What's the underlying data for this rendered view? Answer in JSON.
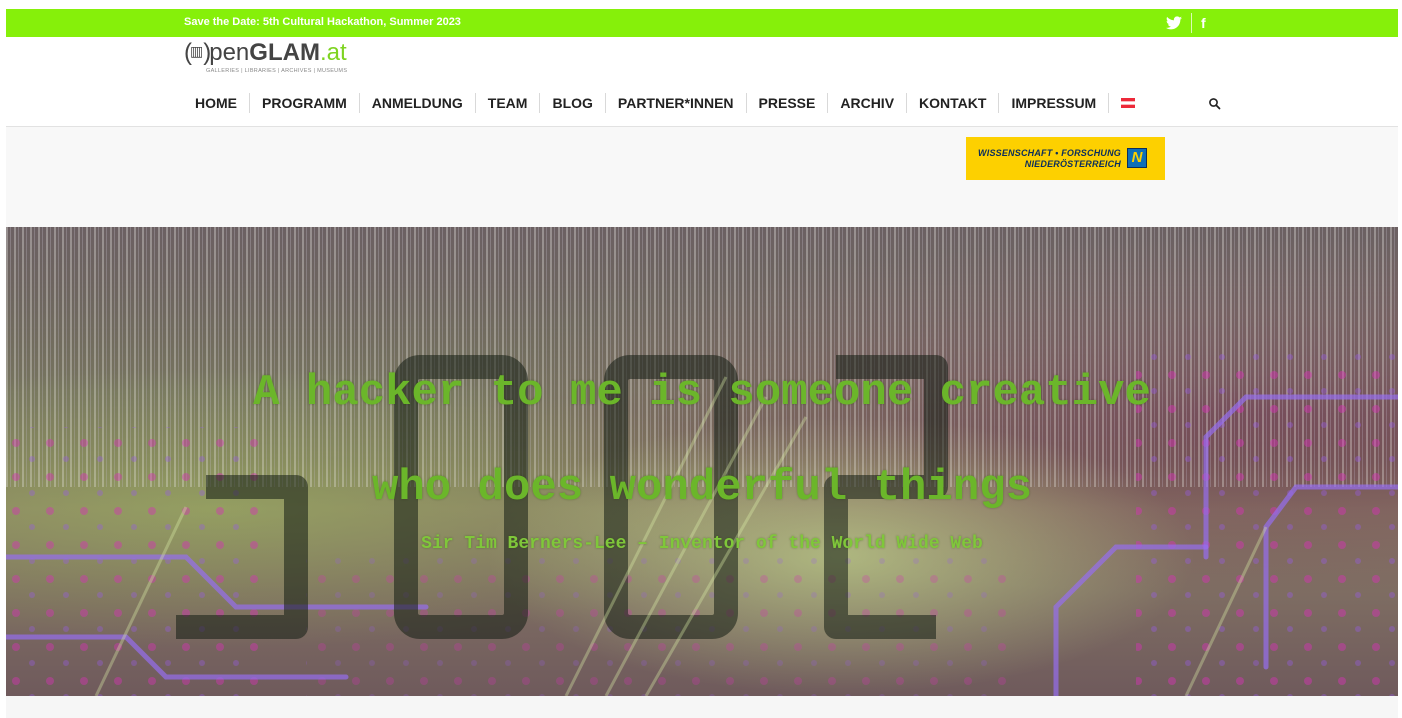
{
  "topbar": {
    "announcement": "Save the Date: 5th Cultural Hackathon, Summer 2023",
    "social": [
      {
        "icon": "twitter-icon"
      },
      {
        "icon": "facebook-icon",
        "glyph": "f"
      }
    ],
    "accent_color": "#86f00a"
  },
  "logo": {
    "bracket": "(",
    "mark": "▥",
    "word_pen": "pen",
    "word_glam": "GLAM",
    "word_at": ".at",
    "subtitle": "GALLERIES | LIBRARIES | ARCHIVES | MUSEUMS"
  },
  "nav": {
    "items": [
      {
        "label": "HOME"
      },
      {
        "label": "PROGRAMM"
      },
      {
        "label": "ANMELDUNG"
      },
      {
        "label": "TEAM"
      },
      {
        "label": "BLOG"
      },
      {
        "label": "PARTNER*INNEN"
      },
      {
        "label": "PRESSE"
      },
      {
        "label": "ARCHIV"
      },
      {
        "label": "KONTAKT"
      },
      {
        "label": "IMPRESSUM"
      }
    ],
    "flag_icon": "austria-flag-icon",
    "search_icon": "search-icon"
  },
  "sponsor": {
    "line1": "WISSENSCHAFT • FORSCHUNG",
    "line2": "NIEDERÖSTERREICH",
    "badge": "N",
    "color": "#fdd000"
  },
  "hero": {
    "quote_line1": "A hacker to me is someone creative",
    "quote_line2": "who does wonderful things",
    "attribution": "Sir Tim Berners-Lee – Inventor of the World Wide Web",
    "text_color": "#6bb62a"
  }
}
